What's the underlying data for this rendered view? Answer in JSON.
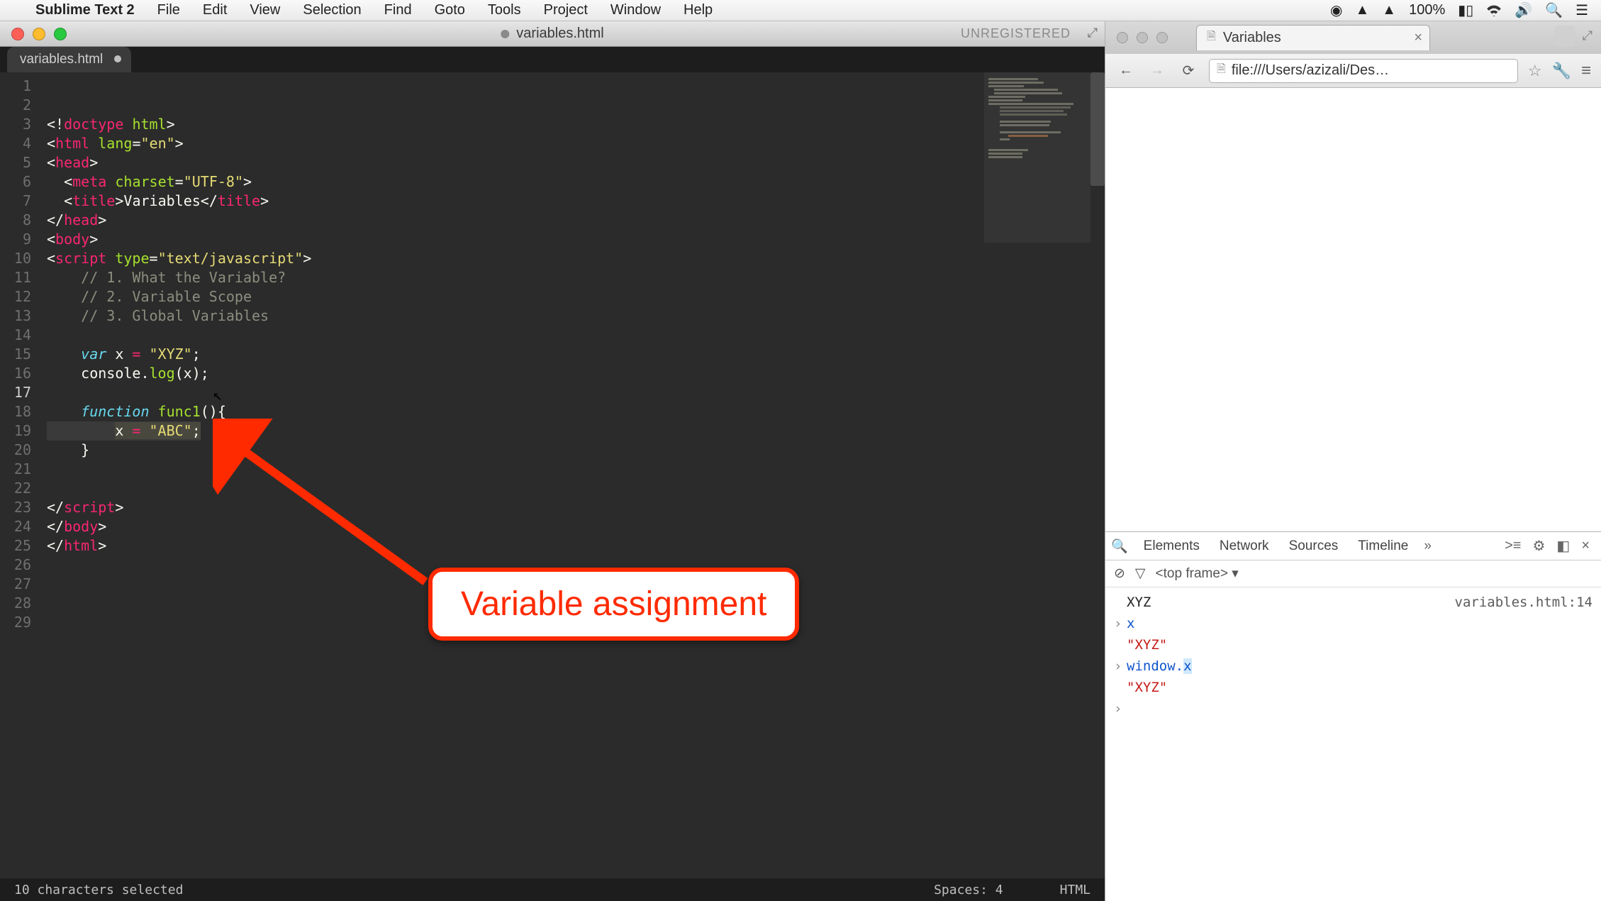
{
  "menubar": {
    "apple": "",
    "app": "Sublime Text 2",
    "items": [
      "File",
      "Edit",
      "View",
      "Selection",
      "Find",
      "Goto",
      "Tools",
      "Project",
      "Window",
      "Help"
    ],
    "battery_pct": "100%"
  },
  "editor": {
    "title_icon": "○",
    "title": "variables.html",
    "unregistered": "UNREGISTERED",
    "tab": "variables.html",
    "code_lines": [
      {
        "n": 1,
        "html": "<span class='pl'>&lt;!</span><span class='tag'>doctype</span> <span class='attr'>html</span><span class='pl'>&gt;</span>"
      },
      {
        "n": 2,
        "html": "<span class='pl'>&lt;</span><span class='tag'>html</span> <span class='attr'>lang</span><span class='pl'>=</span><span class='str'>\"en\"</span><span class='pl'>&gt;</span>"
      },
      {
        "n": 3,
        "html": "<span class='pl'>&lt;</span><span class='tag'>head</span><span class='pl'>&gt;</span>"
      },
      {
        "n": 4,
        "html": "  <span class='pl'>&lt;</span><span class='tag'>meta</span> <span class='attr'>charset</span><span class='pl'>=</span><span class='str'>\"UTF-8\"</span><span class='pl'>&gt;</span>"
      },
      {
        "n": 5,
        "html": "  <span class='pl'>&lt;</span><span class='tag'>title</span><span class='pl'>&gt;</span>Variables<span class='pl'>&lt;/</span><span class='tag'>title</span><span class='pl'>&gt;</span>"
      },
      {
        "n": 6,
        "html": "<span class='pl'>&lt;/</span><span class='tag'>head</span><span class='pl'>&gt;</span>"
      },
      {
        "n": 7,
        "html": "<span class='pl'>&lt;</span><span class='tag'>body</span><span class='pl'>&gt;</span>"
      },
      {
        "n": 8,
        "html": "<span class='pl'>&lt;</span><span class='tag'>script</span> <span class='attr'>type</span><span class='pl'>=</span><span class='str'>\"text/javascript\"</span><span class='pl'>&gt;</span>"
      },
      {
        "n": 9,
        "html": "    <span class='cmt'>// 1. What the Variable?</span>"
      },
      {
        "n": 10,
        "html": "    <span class='cmt'>// 2. Variable Scope</span>"
      },
      {
        "n": 11,
        "html": "    <span class='cmt'>// 3. Global Variables</span>"
      },
      {
        "n": 12,
        "html": ""
      },
      {
        "n": 13,
        "html": "    <span class='kw'>var</span> x <span class='tag'>=</span> <span class='str'>\"XYZ\"</span>;"
      },
      {
        "n": 14,
        "html": "    console.<span class='fn'>log</span>(x);"
      },
      {
        "n": 15,
        "html": ""
      },
      {
        "n": 16,
        "html": "    <span class='kw'>function</span> <span class='fnname'>func1</span>(){"
      },
      {
        "n": 17,
        "html": "        <span class='sel'>x <span class='tag'>=</span> <span class='str'>\"ABC\"</span>;</span>",
        "hl": true
      },
      {
        "n": 18,
        "html": "    }"
      },
      {
        "n": 19,
        "html": ""
      },
      {
        "n": 20,
        "html": ""
      },
      {
        "n": 21,
        "html": "<span class='pl'>&lt;/</span><span class='tag'>script</span><span class='pl'>&gt;</span>"
      },
      {
        "n": 22,
        "html": "<span class='pl'>&lt;/</span><span class='tag'>body</span><span class='pl'>&gt;</span>"
      },
      {
        "n": 23,
        "html": "<span class='pl'>&lt;/</span><span class='tag'>html</span><span class='pl'>&gt;</span>"
      },
      {
        "n": 24,
        "html": ""
      },
      {
        "n": 25,
        "html": ""
      },
      {
        "n": 26,
        "html": ""
      },
      {
        "n": 27,
        "html": ""
      },
      {
        "n": 28,
        "html": ""
      },
      {
        "n": 29,
        "html": ""
      }
    ],
    "status_left": "10 characters selected",
    "status_spaces": "Spaces: 4",
    "status_lang": "HTML"
  },
  "callout": "Variable assignment",
  "browser": {
    "tab_title": "Variables",
    "url": "file:///Users/azizali/Des…",
    "devtools": {
      "tabs": [
        "Elements",
        "Network",
        "Sources",
        "Timeline"
      ],
      "more": "»",
      "frame": "<top frame> ▾",
      "rows": [
        {
          "exp": "",
          "body": "<span class='c-black'>XYZ</span>",
          "link": "variables.html:14"
        },
        {
          "exp": "›",
          "body": "<span class='c-blue'>x</span>"
        },
        {
          "exp": "",
          "body": "<span class='c-red'>\"XYZ\"</span>"
        },
        {
          "exp": "›",
          "body": "<span class='c-blue'>window.</span><span class='c-blue hl-x'>x</span>"
        },
        {
          "exp": "",
          "body": "<span class='c-red'>\"XYZ\"</span>"
        },
        {
          "exp": "›",
          "body": ""
        }
      ]
    }
  }
}
